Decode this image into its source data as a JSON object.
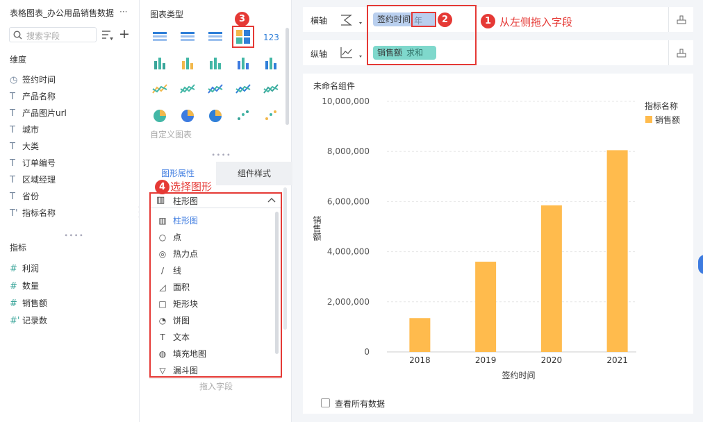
{
  "left": {
    "dataset_title": "表格图表_办公用品销售数据",
    "more_label": "···",
    "search_placeholder": "搜索字段",
    "add_label": "+",
    "dimension_header": "维度",
    "dimensions": [
      {
        "icon": "◷",
        "label": "签约时间"
      },
      {
        "icon": "T",
        "label": "产品名称"
      },
      {
        "icon": "T",
        "label": "产品图片url"
      },
      {
        "icon": "T",
        "label": "城市"
      },
      {
        "icon": "T",
        "label": "大类"
      },
      {
        "icon": "T",
        "label": "订单编号"
      },
      {
        "icon": "T",
        "label": "区域经理"
      },
      {
        "icon": "T",
        "label": "省份"
      },
      {
        "icon": "T'",
        "label": "指标名称"
      }
    ],
    "metric_header": "指标",
    "metrics": [
      {
        "icon": "#",
        "label": "利润"
      },
      {
        "icon": "#",
        "label": "数量"
      },
      {
        "icon": "#",
        "label": "销售额"
      },
      {
        "icon": "#'",
        "label": "记录数"
      }
    ]
  },
  "mid": {
    "chart_type_header": "图表类型",
    "custom_chart_label": "自定义图表",
    "tabs": [
      "图形属性",
      "组件样式"
    ],
    "selected_shape": "柱形图",
    "dropdown_items": [
      {
        "icon": "▥",
        "label": "柱形图",
        "active": true
      },
      {
        "icon": "○",
        "label": "点"
      },
      {
        "icon": "◎",
        "label": "热力点"
      },
      {
        "icon": "∕",
        "label": "线"
      },
      {
        "icon": "◿",
        "label": "面积"
      },
      {
        "icon": "□",
        "label": "矩形块"
      },
      {
        "icon": "◔",
        "label": "饼图"
      },
      {
        "icon": "T",
        "label": "文本"
      },
      {
        "icon": "◍",
        "label": "填充地图"
      },
      {
        "icon": "▽",
        "label": "漏斗图"
      }
    ],
    "drop_hint": "拖入字段"
  },
  "annotations": {
    "b1": "1",
    "b2": "2",
    "b3": "3",
    "b4": "4",
    "t1": "从左侧拖入字段",
    "t4": "选择图形"
  },
  "axes": {
    "x_label": "横轴",
    "x_field": "签约时间",
    "x_tag": "年",
    "y_label": "纵轴",
    "y_field": "销售额",
    "y_tag": "求和"
  },
  "component": {
    "title": "未命名组件",
    "legend_title": "指标名称",
    "show_all_label": "查看所有数据"
  },
  "colors": {
    "bar": "#ffbb4d",
    "accent": "#3d7be0",
    "annotation": "#e53935",
    "field_pill": "#b9cfee",
    "metric_pill": "#7fd8cc"
  },
  "chart_data": {
    "type": "bar",
    "categories": [
      "2018",
      "2019",
      "2020",
      "2021"
    ],
    "values": [
      1350000,
      3600000,
      5850000,
      8050000
    ],
    "ylim": [
      0,
      10000000
    ],
    "yticks": [
      "0",
      "2,000,000",
      "4,000,000",
      "6,000,000",
      "8,000,000",
      "10,000,000"
    ],
    "xlabel": "签约时间",
    "ylabel": "销售额",
    "legend": [
      "销售额"
    ]
  }
}
